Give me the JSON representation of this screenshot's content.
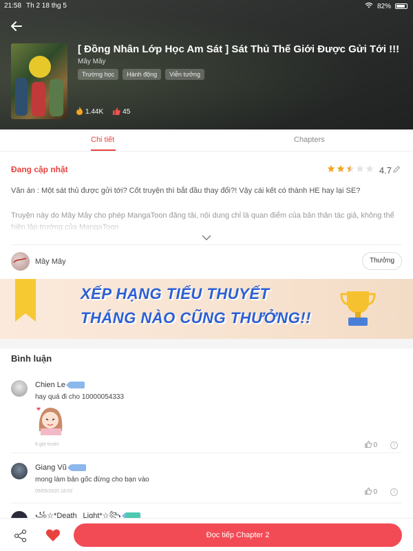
{
  "status_bar": {
    "time": "21:58",
    "date": "Th 2 18 thg 5",
    "battery": "82%"
  },
  "book": {
    "title": "[ Đồng Nhân Lớp Học Am Sát ] Sát Thủ Thế Giới Được Gửi Tới !!!",
    "author": "Mây Mây",
    "tags": [
      "Trường học",
      "Hành động",
      "Viễn tưởng"
    ],
    "views": "1.44K",
    "likes": "45"
  },
  "tabs": [
    {
      "label": "Chi tiết",
      "active": true
    },
    {
      "label": "Chapters",
      "active": false
    }
  ],
  "details": {
    "status": "Đang cập nhật",
    "rating": "4.7",
    "rating_stars": 2.5,
    "summary": "Văn án : Một sát thủ được gửi tới? Cốt truyện thì bắt đầu thay đổi?! Vậy cái kết có thành HE hay lại SE?",
    "notice": "Truyện này do Mây Mây cho phép MangaToon đăng tải, nội dung chỉ là quan điểm của bản thân tác giả, không thể hiện lập trường của MangaToon"
  },
  "author_row": {
    "name": "Mây Mây",
    "tip_button": "Thưởng"
  },
  "banner": {
    "line1": "XẾP HẠNG TIỂU THUYẾT",
    "line2": "THÁNG NÀO CŨNG THƯỞNG!!"
  },
  "comments_section": {
    "title": "Bình luận",
    "comments": [
      {
        "name": "Chien Le",
        "level": "1",
        "text": "hay quá đi cho 10000054333",
        "time": "8 giờ trước",
        "likes": "0"
      },
      {
        "name": "Giang Vũ",
        "level": "4",
        "text": "mong làm bản gốc đừng cho bạn vào",
        "time": "09/05/2020 18:02",
        "likes": "0"
      },
      {
        "name": "꧁☆*Death‿Light*☆꧂",
        "level": "",
        "text": "",
        "time": "",
        "likes": ""
      }
    ]
  },
  "bottom_bar": {
    "read_button": "Đọc tiếp Chapter 2"
  },
  "colors": {
    "accent": "#e8433f",
    "button": "#f24b55",
    "banner_text": "#2a5fd6"
  },
  "icons": [
    "back-arrow-icon",
    "fire-icon",
    "thumbs-up-icon",
    "star-icon",
    "edit-icon",
    "chevron-down-icon",
    "thumbs-up-outline-icon",
    "info-icon",
    "share-icon",
    "heart-icon",
    "trophy-icon"
  ]
}
